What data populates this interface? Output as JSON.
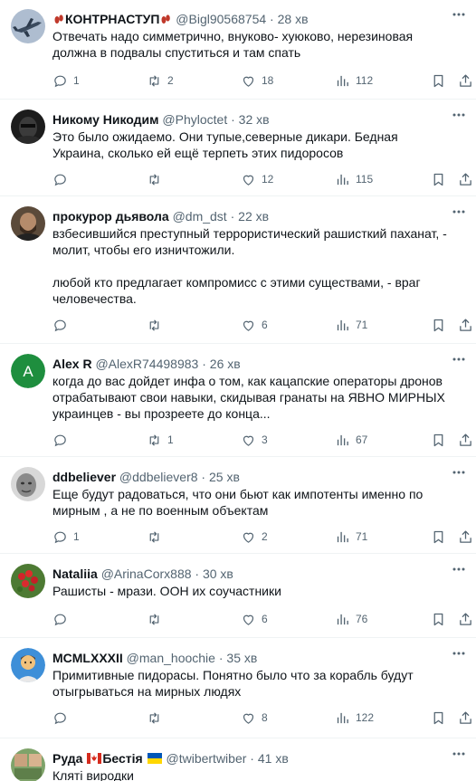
{
  "tweets": [
    {
      "name_prefix_icon": "feet-emoji",
      "name": "КОНТРНАСТУП",
      "name_suffix_icon": "feet-emoji",
      "handle": "@Bigl90568754",
      "dot": "·",
      "time": "28 хв",
      "text": [
        "Отвечать надо симметрично, внуково- хуюково, нерезиновая должна в подвалы спуститься и там спать"
      ],
      "replies": "1",
      "retweets": "2",
      "likes": "18",
      "views": "112",
      "avatar": "fighter-jet"
    },
    {
      "name": "Никому Никодим",
      "handle": "@Phyloctet",
      "dot": "·",
      "time": "32 хв",
      "text": [
        "Это было ожидаемо. Они тупые,северные дикари. Бедная Украина, сколько ей ещё терпеть этих пидоросов"
      ],
      "replies": "",
      "retweets": "",
      "likes": "12",
      "views": "115",
      "avatar": "dark-mask"
    },
    {
      "name": "прокурор дьявола",
      "handle": "@dm_dst",
      "dot": "·",
      "time": "22 хв",
      "text": [
        "взбесившийся преступный террористический рашисткий паханат, - молит, чтобы его изничтожили.",
        "любой кто предлагает компромисс с этими существами, - враг человечества."
      ],
      "replies": "",
      "retweets": "",
      "likes": "6",
      "views": "71",
      "avatar": "bearded-man"
    },
    {
      "name": "Alex R",
      "handle": "@AlexR74498983",
      "dot": "·",
      "time": "26 хв",
      "text": [
        "когда до вас дойдет инфа о том, как кацапские операторы дронов отрабатывают свои навыки, скидывая гранаты на ЯВНО МИРНЫХ украинцев - вы прозреете до конца..."
      ],
      "replies": "",
      "retweets": "1",
      "likes": "3",
      "views": "67",
      "avatar": "letter-a",
      "avatar_letter": "A",
      "avatar_color": "#1e8e3e"
    },
    {
      "name": "ddbeliever",
      "handle": "@ddbeliever8",
      "dot": "·",
      "time": "25 хв",
      "text": [
        "Еще будут радоваться, что они бьют как импотенты  именно по мирным , а не по военным объектам"
      ],
      "replies": "1",
      "retweets": "",
      "likes": "2",
      "views": "71",
      "avatar": "grey-face"
    },
    {
      "name": "Nataliia",
      "handle": "@ArinaCorx888",
      "dot": "·",
      "time": "30 хв",
      "text": [
        "Рашисты - мрази. ООН их соучастники"
      ],
      "replies": "",
      "retweets": "",
      "likes": "6",
      "views": "76",
      "avatar": "red-berries"
    },
    {
      "name": "MCMLXXXII",
      "handle": "@man_hoochie",
      "dot": "·",
      "time": "35 хв",
      "text": [
        "Примитивные пидорасы. Понятно было что за корабль будут отыгрываться на мирных людях"
      ],
      "replies": "",
      "retweets": "",
      "likes": "8",
      "views": "122",
      "avatar": "cartoon-man"
    },
    {
      "name": "Руда",
      "name_mid_icon": "canada-flag-emoji",
      "name2": "Бестія",
      "name_suffix_icon": "ukraine-flag-emoji",
      "handle": "@twibertwiber",
      "dot": "·",
      "time": "41 хв",
      "text": [
        "Кляті виродки"
      ],
      "replies": "",
      "retweets": "",
      "likes": "",
      "views": "",
      "avatar": "photo-group"
    }
  ],
  "colors": {
    "text": "#0f1419",
    "muted": "#536471",
    "divider": "#eff3f4",
    "like_red": "#f91880"
  }
}
